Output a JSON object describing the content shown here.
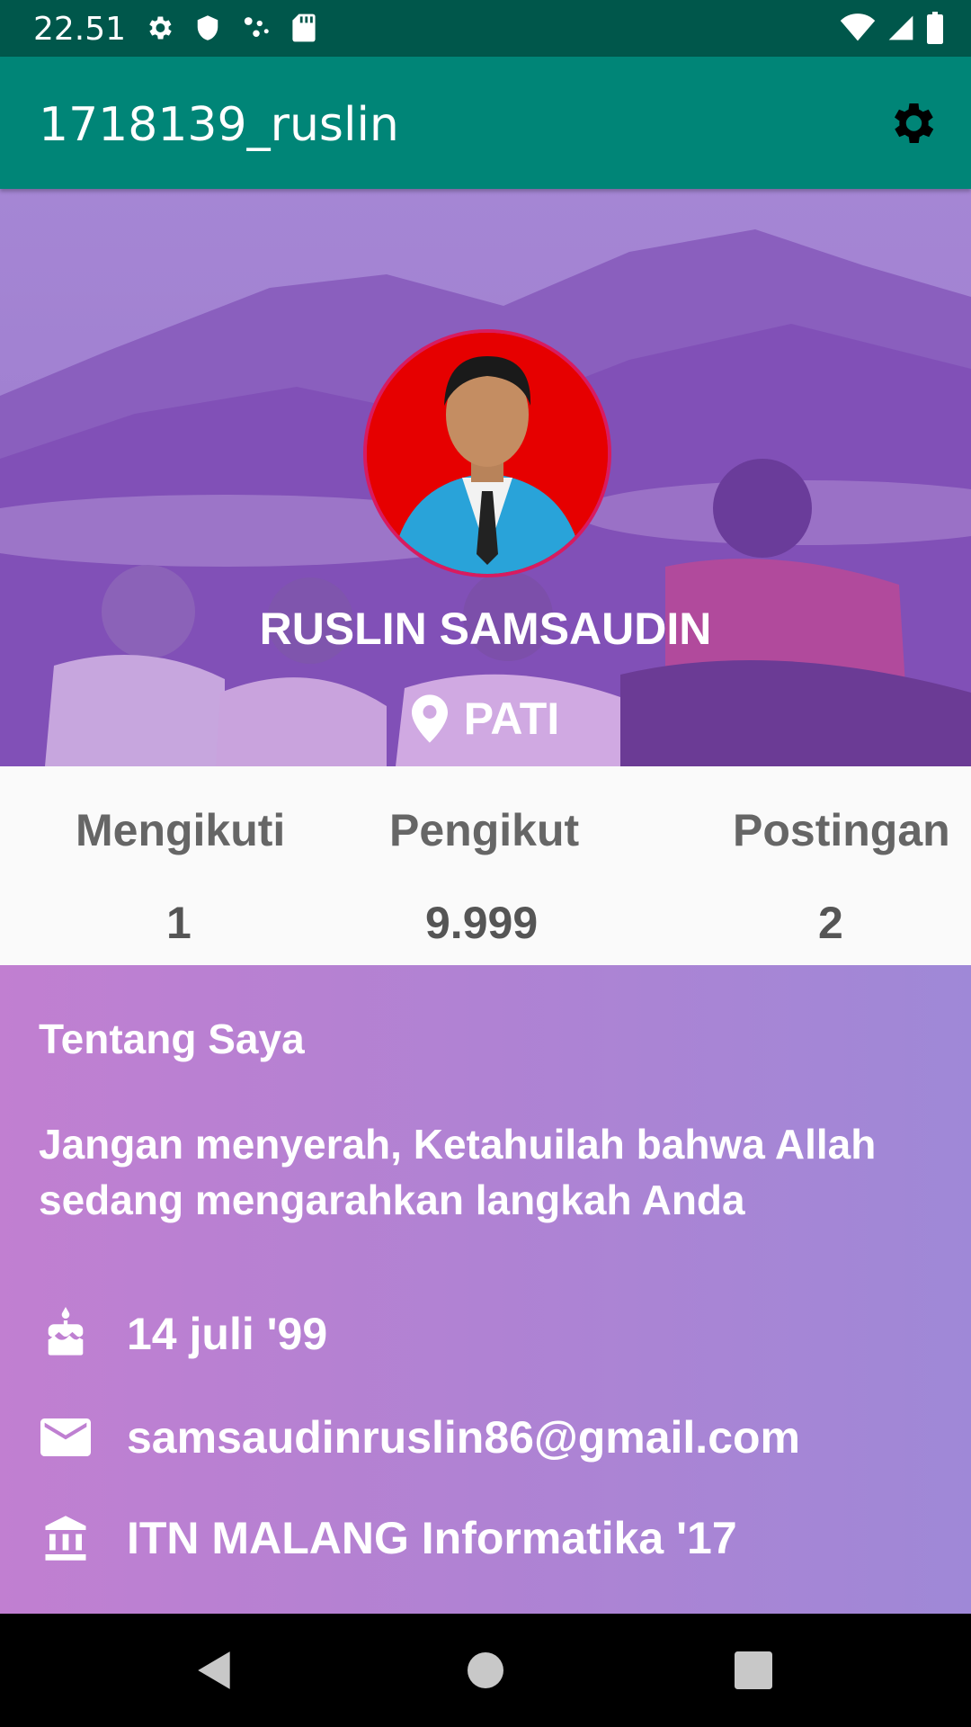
{
  "status_bar": {
    "time": "22.51"
  },
  "app_bar": {
    "title": "1718139_ruslin"
  },
  "profile": {
    "name": "RUSLIN SAMSAUDIN",
    "location": "PATI"
  },
  "stats": [
    {
      "label": "Mengikuti",
      "value": "1"
    },
    {
      "label": "Pengikut",
      "value": "9.999"
    },
    {
      "label": "Postingan",
      "value": "2"
    }
  ],
  "about": {
    "heading": "Tentang Saya",
    "bio": "Jangan menyerah, Ketahuilah bahwa Allah sedang mengarahkan langkah Anda",
    "birthday": "14 juli '99",
    "email": "samsaudinruslin86@gmail.com",
    "education": "ITN MALANG Informatika '17"
  },
  "colors": {
    "status_bar": "#00574b",
    "app_bar": "#008577",
    "avatar_border": "#d81b60",
    "avatar_bg": "#e60000"
  },
  "icons": {
    "app_bar_action": "settings-gear-icon",
    "location": "map-pin-icon",
    "birthday": "cake-icon",
    "email": "mail-icon",
    "education": "institution-icon"
  }
}
